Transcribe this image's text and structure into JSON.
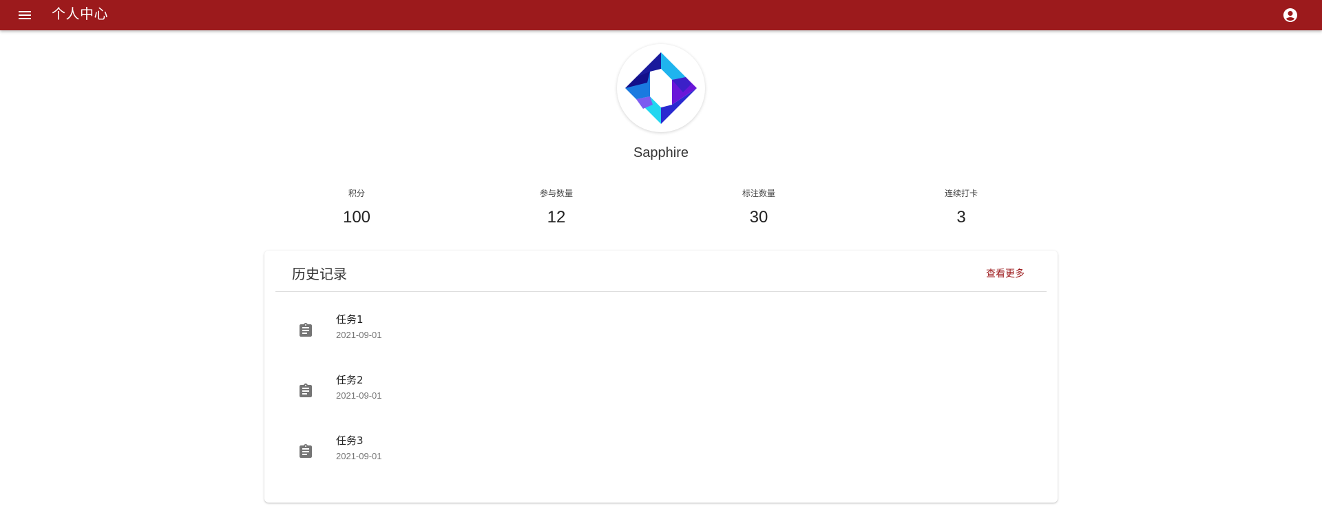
{
  "appbar": {
    "title": "个人中心",
    "menu_icon": "menu-icon",
    "account_icon": "account-circle-icon",
    "background_color": "#9c1a1c"
  },
  "profile": {
    "name": "Sapphire",
    "avatar_icon": "sapphire-logo"
  },
  "stats": [
    {
      "label": "积分",
      "value": "100"
    },
    {
      "label": "参与数量",
      "value": "12"
    },
    {
      "label": "标注数量",
      "value": "30"
    },
    {
      "label": "连续打卡",
      "value": "3"
    }
  ],
  "history": {
    "title": "历史记录",
    "more_label": "查看更多",
    "item_icon": "clipboard-icon",
    "items": [
      {
        "title": "任务1",
        "date": "2021-09-01"
      },
      {
        "title": "任务2",
        "date": "2021-09-01"
      },
      {
        "title": "任务3",
        "date": "2021-09-01"
      }
    ]
  },
  "colors": {
    "accent": "#9c1a1c",
    "icon_gray": "#757575"
  }
}
